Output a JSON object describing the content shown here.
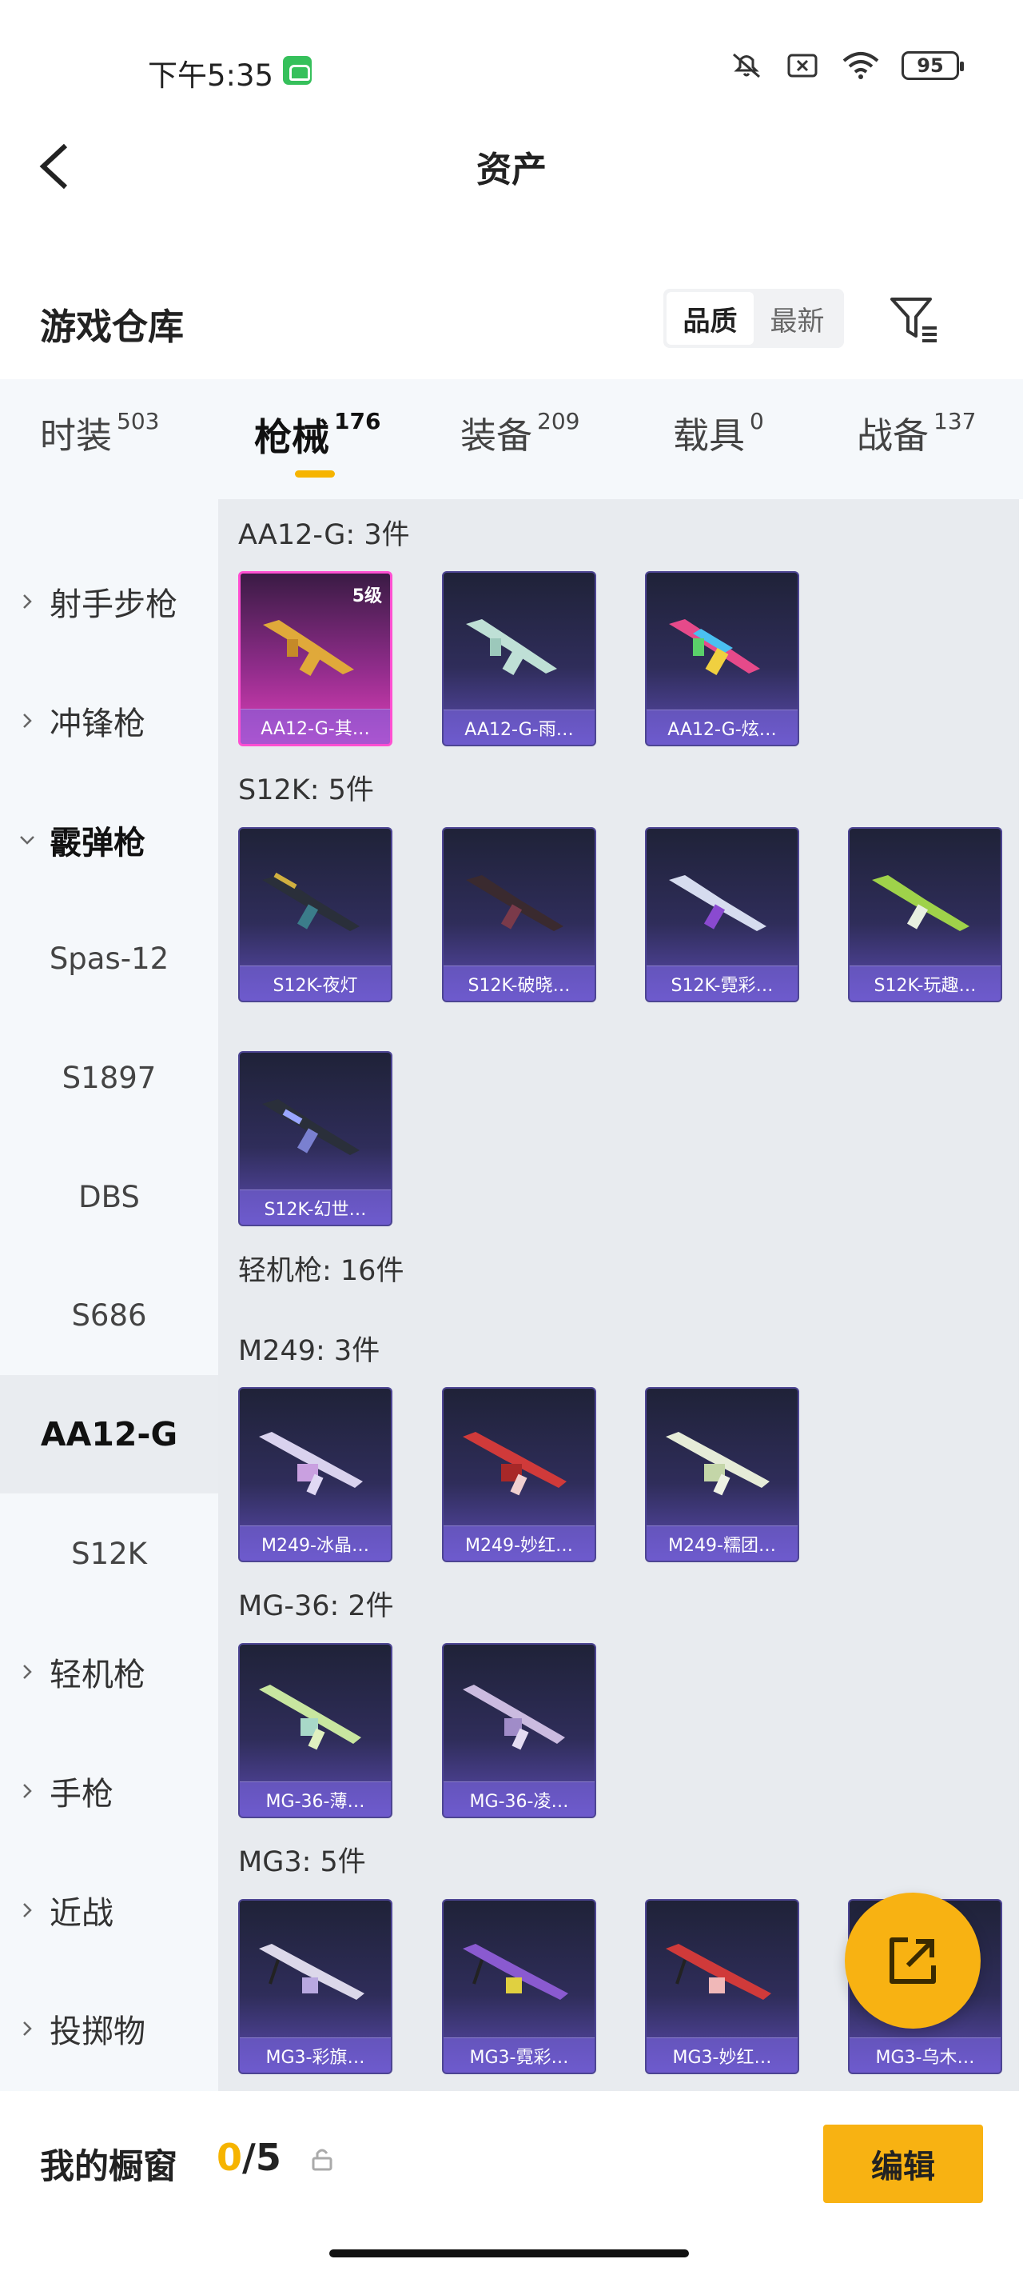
{
  "status_bar": {
    "time": "下午5:35",
    "battery": "95"
  },
  "header": {
    "title": "资产",
    "back_icon": "back-arrow-icon"
  },
  "warehouse": {
    "title": "游戏仓库",
    "sort_options": [
      "品质",
      "最新"
    ],
    "sort_selected": "品质",
    "filter_icon": "filter-icon"
  },
  "tabs": [
    {
      "label": "时装",
      "count": "503"
    },
    {
      "label": "枪械",
      "count": "176"
    },
    {
      "label": "装备",
      "count": "209"
    },
    {
      "label": "载具",
      "count": "0"
    },
    {
      "label": "战备",
      "count": "137"
    }
  ],
  "active_tab": "枪械",
  "sidebar": [
    {
      "label": "射手步枪",
      "type": "parent"
    },
    {
      "label": "冲锋枪",
      "type": "parent"
    },
    {
      "label": "霰弹枪",
      "type": "parent",
      "open": true
    },
    {
      "label": "Spas-12",
      "type": "child"
    },
    {
      "label": "S1897",
      "type": "child"
    },
    {
      "label": "DBS",
      "type": "child"
    },
    {
      "label": "S686",
      "type": "child"
    },
    {
      "label": "AA12-G",
      "type": "child",
      "active": true
    },
    {
      "label": "S12K",
      "type": "child"
    },
    {
      "label": "轻机枪",
      "type": "parent"
    },
    {
      "label": "手枪",
      "type": "parent"
    },
    {
      "label": "近战",
      "type": "parent"
    },
    {
      "label": "投掷物",
      "type": "parent"
    }
  ],
  "groups": [
    {
      "title": "AA12-G: 3件",
      "items": [
        {
          "label": "AA12-G-其…",
          "level": "5级",
          "rarity": "pink"
        },
        {
          "label": "AA12-G-雨…"
        },
        {
          "label": "AA12-G-炫…"
        }
      ]
    },
    {
      "title": "S12K: 5件",
      "items": [
        {
          "label": "S12K-夜灯"
        },
        {
          "label": "S12K-破晓…"
        },
        {
          "label": "S12K-霓彩…"
        },
        {
          "label": "S12K-玩趣…"
        },
        {
          "label": "S12K-幻世…"
        }
      ]
    },
    {
      "title": "轻机枪: 16件",
      "items": []
    },
    {
      "title": "M249: 3件",
      "items": [
        {
          "label": "M249-冰晶…"
        },
        {
          "label": "M249-妙红…"
        },
        {
          "label": "M249-糯团…"
        }
      ]
    },
    {
      "title": "MG-36: 2件",
      "items": [
        {
          "label": "MG-36-薄…"
        },
        {
          "label": "MG-36-凌…"
        }
      ]
    },
    {
      "title": "MG3: 5件",
      "items": [
        {
          "label": "MG3-彩旗…"
        },
        {
          "label": "MG3-霓彩…"
        },
        {
          "label": "MG3-妙红…"
        },
        {
          "label": "MG3-乌木…"
        }
      ]
    }
  ],
  "fab": {
    "icon": "share-external-icon"
  },
  "bottom": {
    "title": "我的橱窗",
    "current": "0",
    "total": "/5",
    "lock_icon": "lock-icon",
    "edit_label": "编辑"
  }
}
